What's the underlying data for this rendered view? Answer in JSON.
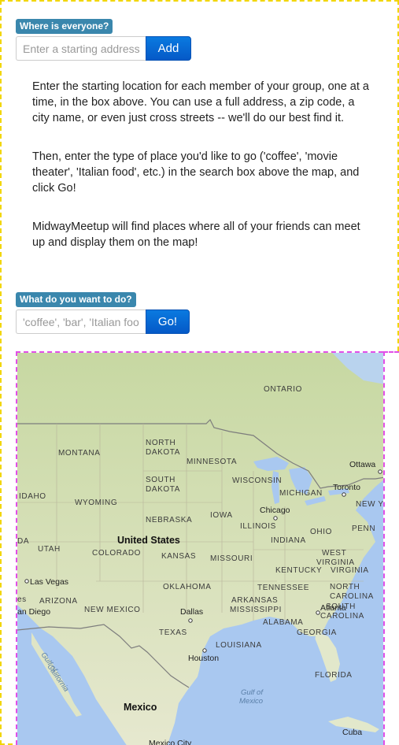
{
  "section1": {
    "badge": "Where is everyone?",
    "address_placeholder": "Enter a starting address",
    "add_label": "Add"
  },
  "instructions": {
    "p1": "Enter the starting location for each member of your group, one at a time, in the box above. You can use a full address, a zip code, a city name, or even just cross streets -- we'll do our best find it.",
    "p2": "Then, enter the type of place you'd like to go ('coffee', 'movie theater', 'Italian food', etc.) in the search box above the map, and click Go!",
    "p3": "MidwayMeetup will find places where all of your friends can meet up and display them on the map!"
  },
  "section2": {
    "badge": "What do you want to do?",
    "search_placeholder": "'coffee', 'bar', 'Italian food'",
    "go_label": "Go!"
  },
  "map": {
    "countries": {
      "us": "United States",
      "mexico": "Mexico",
      "cuba": "Cuba"
    },
    "regions": {
      "ontario": "ONTARIO",
      "north_dakota_1": "NORTH",
      "north_dakota_2": "DAKOTA",
      "montana": "MONTANA",
      "minnesota": "MINNESOTA",
      "south_dakota_1": "SOUTH",
      "south_dakota_2": "DAKOTA",
      "wisconsin": "WISCONSIN",
      "michigan": "MICHIGAN",
      "idaho": "IDAHO",
      "wyoming": "WYOMING",
      "nebraska": "NEBRASKA",
      "iowa": "IOWA",
      "illinois": "ILLINOIS",
      "ohio": "OHIO",
      "penn": "PENN",
      "new_york": "NEW YOR",
      "utah": "UTAH",
      "colorado": "COLORADO",
      "kansas": "KANSAS",
      "missouri": "MISSOURI",
      "indiana": "INDIANA",
      "west_virginia_1": "WEST",
      "west_virginia_2": "VIRGINIA",
      "kentucky": "KENTUCKY",
      "virginia": "VIRGINIA",
      "oklahoma": "OKLAHOMA",
      "tennessee": "TENNESSEE",
      "north_carolina_1": "NORTH",
      "north_carolina_2": "CAROLINA",
      "arizona": "ARIZONA",
      "new_mexico": "NEW MEXICO",
      "arkansas": "ARKANSAS",
      "mississippi": "MISSISSIPPI",
      "alabama": "ALABAMA",
      "south_carolina_1": "SOUTH",
      "south_carolina_2": "CAROLINA",
      "georgia": "GEORGIA",
      "texas": "TEXAS",
      "louisiana": "LOUISIANA",
      "florida": "FLORIDA",
      "da": "DA",
      "es": "es"
    },
    "cities": {
      "ottawa": "Ottawa",
      "toronto": "Toronto",
      "chicago": "Chicago",
      "las_vegas": "Las Vegas",
      "san_diego": "an Diego",
      "dallas": "Dallas",
      "atlanta": "Atlanta",
      "houston": "Houston",
      "mexico_city": "Mexico City"
    },
    "water": {
      "gulf_california_1": "Gulf of",
      "gulf_california_2": "California",
      "gulf_mexico_1": "Gulf of",
      "gulf_mexico_2": "Mexico"
    },
    "colors": {
      "land": "#e3e8cf",
      "land_green": "#c9d9a5",
      "water": "#a9c8f0",
      "border": "#8a8a8a"
    }
  }
}
